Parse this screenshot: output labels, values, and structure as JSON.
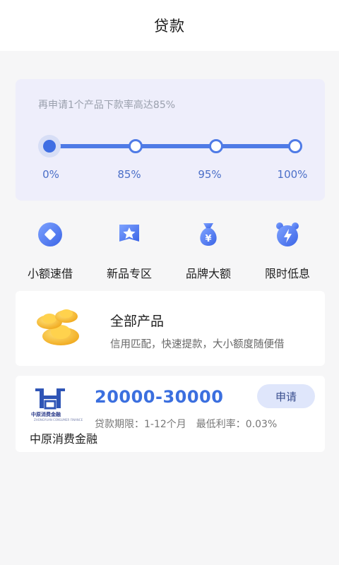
{
  "header": {
    "title": "贷款"
  },
  "progress": {
    "hint": "再申请1个产品下款率高达85%",
    "ticks": [
      "0%",
      "85%",
      "95%",
      "100%"
    ],
    "current_index": 0
  },
  "features": [
    {
      "label": "小额速借",
      "icon": "diamond-icon"
    },
    {
      "label": "新品专区",
      "icon": "star-badge-icon"
    },
    {
      "label": "品牌大额",
      "icon": "money-bag-icon"
    },
    {
      "label": "限时低息",
      "icon": "alarm-clock-icon"
    }
  ],
  "all_products": {
    "title": "全部产品",
    "desc": "信用匹配，快速提款，大小额度随便借",
    "icon": "gold-ingot-icon"
  },
  "loan": {
    "logo_text": "中原消费金融",
    "logo_subtext": "ZHONGYUAN CONSUMER FINANCE",
    "amount": "20000-30000",
    "apply_label": "申请",
    "term": "贷款期限：1-12个月",
    "rate": "最低利率：0.03%",
    "company": "中原消费金融"
  },
  "colors": {
    "accent": "#4f7be6",
    "card_bg": "#eeeefb",
    "page_bg": "#f6f6f7"
  }
}
